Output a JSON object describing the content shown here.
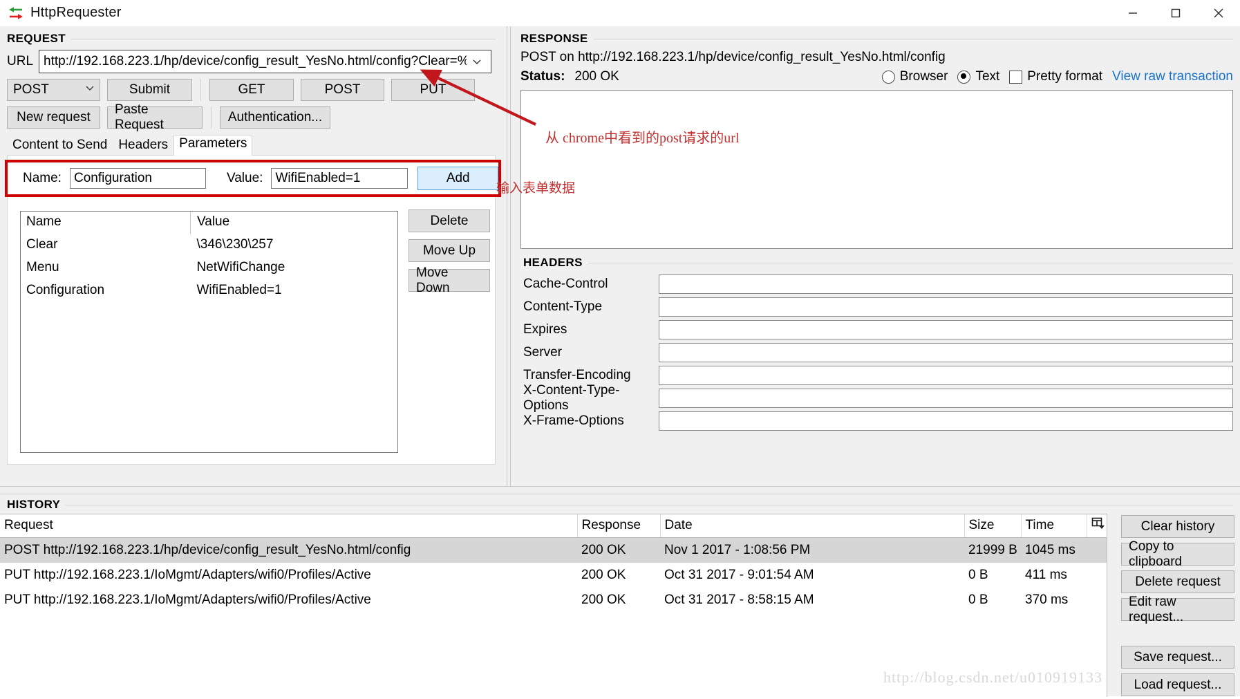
{
  "window": {
    "title": "HttpRequester",
    "icon": "http-arrows-icon",
    "minimize_label": "—",
    "maximize_label": "☐",
    "close_label": "✕"
  },
  "request": {
    "section_title": "REQUEST",
    "url_label": "URL",
    "url_value": "http://192.168.223.1/hp/device/config_result_YesNo.html/config?Clear=%",
    "url_placeholder": "",
    "method_selected": "POST",
    "buttons_row1": [
      "Submit",
      "GET",
      "POST",
      "PUT"
    ],
    "buttons_row2": [
      "New request",
      "Paste Request",
      "Authentication..."
    ],
    "tabs": [
      {
        "label": "Content to Send",
        "active": false
      },
      {
        "label": "Headers",
        "active": false
      },
      {
        "label": "Parameters",
        "active": true
      }
    ],
    "param_form": {
      "name_label": "Name:",
      "name_value": "Configuration",
      "value_label": "Value:",
      "value_value": "WifiEnabled=1",
      "add_label": "Add"
    },
    "param_table": {
      "columns": [
        "Name",
        "Value"
      ],
      "rows": [
        {
          "name": "Clear",
          "value": "\\346\\230\\257"
        },
        {
          "name": "Menu",
          "value": "NetWifiChange"
        },
        {
          "name": "Configuration",
          "value": "WifiEnabled=1"
        }
      ]
    },
    "param_side_buttons": [
      "Delete",
      "Move Up",
      "Move Down"
    ]
  },
  "response": {
    "section_title": "RESPONSE",
    "request_line": "POST on http://192.168.223.1/hp/device/config_result_YesNo.html/config",
    "status_label": "Status:",
    "status_value": "200 OK",
    "view_browser_label": "Browser",
    "view_text_label": "Text",
    "view_selected": "Text",
    "pretty_format_label": "Pretty format",
    "pretty_format_checked": false,
    "view_raw_label": "View raw transaction",
    "link_color": "#1a73c8",
    "body_text": ""
  },
  "headers": {
    "section_title": "HEADERS",
    "rows": [
      {
        "label": "Cache-Control",
        "value": ""
      },
      {
        "label": "Content-Type",
        "value": ""
      },
      {
        "label": "Expires",
        "value": ""
      },
      {
        "label": "Server",
        "value": ""
      },
      {
        "label": "Transfer-Encoding",
        "value": ""
      },
      {
        "label": "X-Content-Type-Options",
        "value": ""
      },
      {
        "label": "X-Frame-Options",
        "value": ""
      }
    ]
  },
  "history": {
    "section_title": "HISTORY",
    "columns": [
      "Request",
      "Response",
      "Date",
      "Size",
      "Time"
    ],
    "column_selector_icon": "column-selector-icon",
    "rows": [
      {
        "request": "POST http://192.168.223.1/hp/device/config_result_YesNo.html/config",
        "response": "200 OK",
        "date": "Nov 1 2017 - 1:08:56 PM",
        "size": "21999 B",
        "time": "1045 ms",
        "selected": true
      },
      {
        "request": "PUT http://192.168.223.1/IoMgmt/Adapters/wifi0/Profiles/Active",
        "response": "200 OK",
        "date": "Oct 31 2017 - 9:01:54 AM",
        "size": "0 B",
        "time": "411 ms",
        "selected": false
      },
      {
        "request": "PUT http://192.168.223.1/IoMgmt/Adapters/wifi0/Profiles/Active",
        "response": "200 OK",
        "date": "Oct 31 2017 - 8:58:15 AM",
        "size": "0 B",
        "time": "370 ms",
        "selected": false
      }
    ],
    "buttons": [
      "Clear history",
      "Copy to clipboard",
      "Delete request",
      "Edit raw request..."
    ],
    "buttons_lower": [
      "Save request...",
      "Load request..."
    ]
  },
  "annotations": {
    "url_note": "从 chrome中看到的post请求的url",
    "form_note": "输入表单数据",
    "color": "#c23030"
  },
  "watermark": {
    "text": "http://blog.csdn.net/u010919133"
  }
}
